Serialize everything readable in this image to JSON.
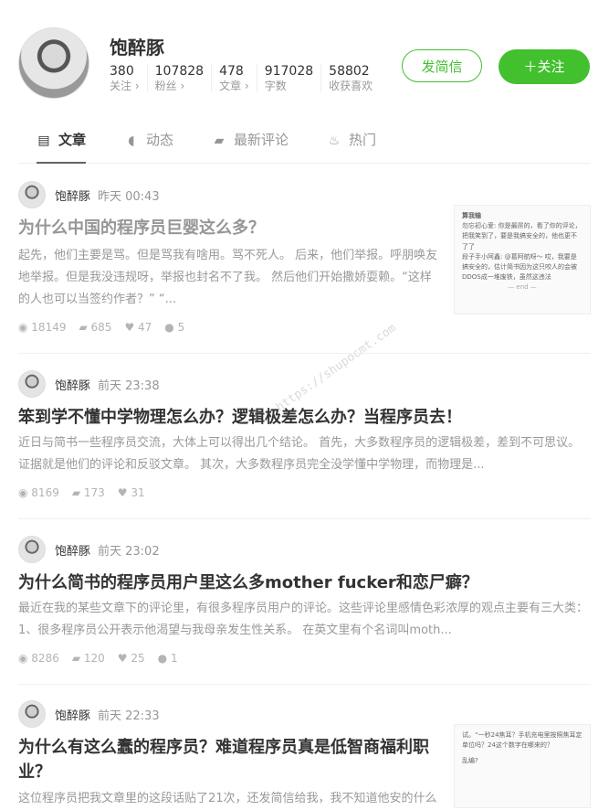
{
  "profile": {
    "name": "饱醉豚",
    "stats": [
      {
        "value": "380",
        "label": "关注 ›"
      },
      {
        "value": "107828",
        "label": "粉丝 ›"
      },
      {
        "value": "478",
        "label": "文章 ›"
      },
      {
        "value": "917028",
        "label": "字数"
      },
      {
        "value": "58802",
        "label": "收获喜欢"
      }
    ],
    "message_button": "发简信",
    "follow_button": "＋关注"
  },
  "tabs": [
    {
      "label": "文章",
      "icon": "document-icon",
      "glyph": "▤"
    },
    {
      "label": "动态",
      "icon": "bell-icon",
      "glyph": "◖"
    },
    {
      "label": "最新评论",
      "icon": "comment-icon",
      "glyph": "▰"
    },
    {
      "label": "热门",
      "icon": "fire-icon",
      "glyph": "♨"
    }
  ],
  "watermark": "https://shupocmt.com",
  "articles": [
    {
      "author": "饱醉豚",
      "time": "昨天 00:43",
      "title": "为什么中国的程序员巨婴这么多？",
      "abstract": "起先，他们主要是骂。但是骂我有啥用。骂不死人。 后来，他们举报。呼朋唤友地举报。但是我没违规呀，举报也封名不了我。 然后他们开始撒娇耍赖。“这样的人也可以当签约作者？” “...",
      "views": "18149",
      "comments": "685",
      "likes": "47",
      "rewards": "5",
      "thumb_lines": [
        "算我输",
        "",
        "勿忘初心爱: 你是最屌的，看了你的评论，把我笑到了，要是我搞安全的，他也更不了了",
        "",
        "段子手小阿鑫: @葛阿航呀～ 哎，我要是搞安全的，估计简书因为这只咬人的会被DDOS成一堆废铁，虽然这违法",
        "",
        "— end —"
      ]
    },
    {
      "author": "饱醉豚",
      "time": "前天 23:38",
      "title": "笨到学不懂中学物理怎么办？逻辑极差怎么办？当程序员去！",
      "abstract": "近日与简书一些程序员交流，大体上可以得出几个结论。 首先，大多数程序员的逻辑极差，差到不可思议。证据就是他们的评论和反驳文章。 其次，大多数程序员完全没学懂中学物理，而物理是...",
      "views": "8169",
      "comments": "173",
      "likes": "31"
    },
    {
      "author": "饱醉豚",
      "time": "前天 23:02",
      "title": "为什么简书的程序员用户里这么多mother fucker和恋尸癖？",
      "abstract": "最近在我的某些文章下的评论里，有很多程序员用户的评论。这些评论里感情色彩浓厚的观点主要有三大类： 1、很多程序员公开表示他渴望与我母亲发生性关系。 在英文里有个名词叫moth...",
      "views": "8286",
      "comments": "120",
      "likes": "25",
      "rewards": "1"
    },
    {
      "author": "饱醉豚",
      "time": "前天 22:33",
      "title": "为什么有这么蠢的程序员？难道程序员真是低智商福利职业？",
      "abstract": "这位程序员把我文章里的这段话贴了21次，还发简信给我，我不知道他安的什么",
      "thumb_lines": [
        "试。“一秒24焦耳？手机充电里按照焦耳定单位吗？24这个数字在哪来的？",
        "",
        "乱编?"
      ]
    }
  ]
}
